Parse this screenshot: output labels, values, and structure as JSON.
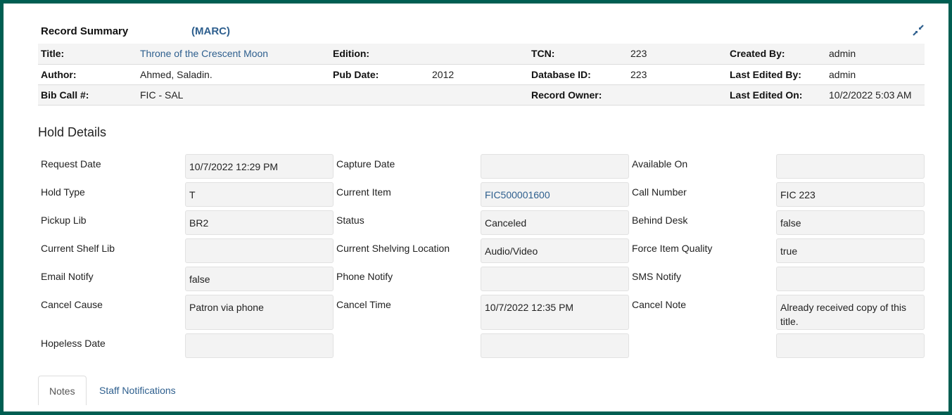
{
  "record_summary": {
    "title": "Record Summary",
    "marc_link": "(MARC)",
    "collapse_icon": "collapse-arrows-icon",
    "rows": [
      [
        {
          "label": "Title:",
          "value": "Throne of the Crescent Moon",
          "link": true
        },
        {
          "label": "Edition:",
          "value": ""
        },
        {
          "label": "TCN:",
          "value": "223"
        },
        {
          "label": "Created By:",
          "value": "admin"
        }
      ],
      [
        {
          "label": "Author:",
          "value": "Ahmed, Saladin."
        },
        {
          "label": "Pub Date:",
          "value": "2012"
        },
        {
          "label": "Database ID:",
          "value": "223"
        },
        {
          "label": "Last Edited By:",
          "value": "admin"
        }
      ],
      [
        {
          "label": "Bib Call #:",
          "value": "FIC - SAL"
        },
        {
          "label": "",
          "value": ""
        },
        {
          "label": "Record Owner:",
          "value": ""
        },
        {
          "label": "Last Edited On:",
          "value": "10/2/2022 5:03 AM"
        }
      ]
    ]
  },
  "hold_details": {
    "title": "Hold Details",
    "rows": [
      [
        {
          "label": "Request Date",
          "value": "10/7/2022 12:29 PM"
        },
        {
          "label": "Capture Date",
          "value": ""
        },
        {
          "label": "Available On",
          "value": ""
        }
      ],
      [
        {
          "label": "Hold Type",
          "value": "T"
        },
        {
          "label": "Current Item",
          "value": "FIC500001600",
          "link": true
        },
        {
          "label": "Call Number",
          "value": "FIC 223"
        }
      ],
      [
        {
          "label": "Pickup Lib",
          "value": "BR2"
        },
        {
          "label": "Status",
          "value": "Canceled"
        },
        {
          "label": "Behind Desk",
          "value": "false"
        }
      ],
      [
        {
          "label": "Current Shelf Lib",
          "value": ""
        },
        {
          "label": "Current Shelving Location",
          "value": "Audio/Video"
        },
        {
          "label": "Force Item Quality",
          "value": "true"
        }
      ],
      [
        {
          "label": "Email Notify",
          "value": "false"
        },
        {
          "label": "Phone Notify",
          "value": ""
        },
        {
          "label": "SMS Notify",
          "value": ""
        }
      ],
      [
        {
          "label": "Cancel Cause",
          "value": "Patron via phone"
        },
        {
          "label": "Cancel Time",
          "value": "10/7/2022 12:35 PM"
        },
        {
          "label": "Cancel Note",
          "value": "Already received copy of this title."
        }
      ],
      [
        {
          "label": "Hopeless Date",
          "value": ""
        },
        {
          "label": "",
          "value": ""
        },
        {
          "label": "",
          "value": ""
        }
      ]
    ]
  },
  "tabs": [
    {
      "label": "Notes",
      "active": true
    },
    {
      "label": "Staff Notifications",
      "active": false
    }
  ],
  "colors": {
    "frame": "#005e52",
    "link": "#2e5f8e"
  }
}
